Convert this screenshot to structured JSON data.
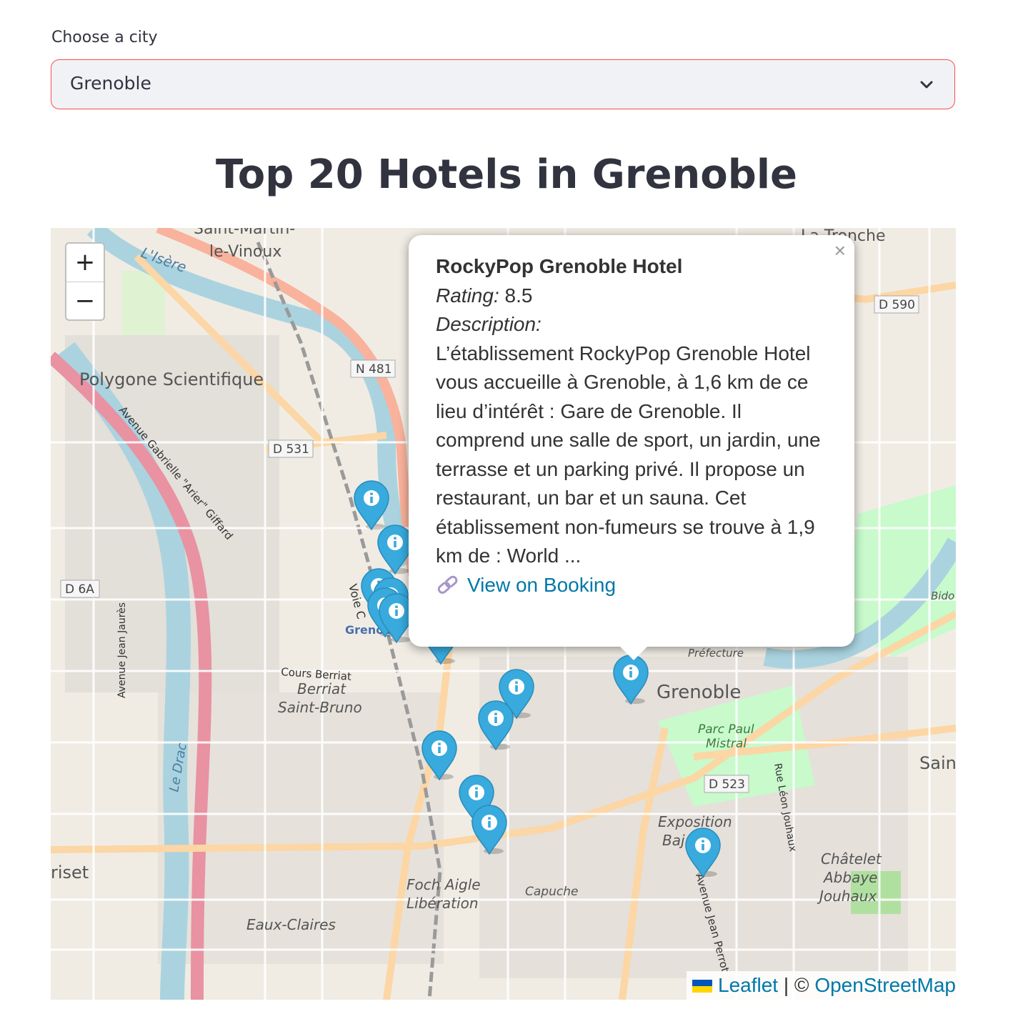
{
  "city_select": {
    "label": "Choose a city",
    "value": "Grenoble"
  },
  "title": "Top 20 Hotels in Grenoble",
  "map": {
    "zoom_in": "+",
    "zoom_out": "−",
    "place_labels": {
      "saint_martin": "Saint-Martin-",
      "le_vinoux": "le-Vinoux",
      "isere": "L'Isère",
      "polygone": "Polygone Scientifique",
      "n481": "N 481",
      "d531": "D 531",
      "d590": "D 590",
      "d6a": "D 6A",
      "d523": "D 523",
      "avenue_gabrielle": "Avenue Gabrielle \"Arier\" Giffard",
      "grenoble_station": "Grenoble",
      "cours_berriat": "Cours Berriat",
      "berriat": "Berriat",
      "saint_bruno": "Saint-Bruno",
      "avenue_jaures": "Avenue Jean Jaurès",
      "le_drac": "Le Drac",
      "prefecture": "Préfecture",
      "grenoble_city": "Grenoble",
      "parc_paul": "Parc Paul",
      "mistral": "Mistral",
      "exposition": "Exposition",
      "bajatiere": "Baj",
      "rue_jouhaux": "Rue Léon Jouhaux",
      "chatelet": "Châtelet",
      "abbaye": "Abbaye",
      "jouhaux": "Jouhaux",
      "foch": "Foch Aigle",
      "liberation": "Libération",
      "capuche": "Capuche",
      "eaux_claires": "Eaux-Claires",
      "avenue_perrot": "Avenue Jean Perrot",
      "seyssinet": "riset",
      "la_tronche": "La Tronche",
      "saint_m": "Sain",
      "bidon": "Bido",
      "voie": "Voie C"
    },
    "marker_icon": "info-marker-icon",
    "popup": {
      "name": "RockyPop Grenoble Hotel",
      "rating_label": "Rating:",
      "rating_value": "8.5",
      "description_label": "Description:",
      "description": "L’établissement RockyPop Grenoble Hotel vous accueille à Grenoble, à 1,6 km de ce lieu d’intérêt : Gare de Grenoble. Il comprend une salle de sport, un jardin, une terrasse et un parking privé. Il propose un restaurant, un bar et un sauna. Cet établissement non-fumeurs se trouve à 1,9 km de : World ...",
      "link_label": "View on Booking",
      "close": "×"
    },
    "attribution": {
      "leaflet": "Leaflet",
      "separator": " | © ",
      "osm": "OpenStreetMap"
    }
  },
  "colors": {
    "accent_border": "#ff4b4b",
    "select_bg": "#f0f2f6",
    "marker_blue": "#38aadd",
    "link_blue": "#0078a8",
    "motorway_pink": "#e892a2",
    "trunk_orange": "#f9b29c",
    "primary_yellow": "#fcd6a4",
    "water_blue": "#aad3df",
    "park_green": "#c8facc"
  }
}
